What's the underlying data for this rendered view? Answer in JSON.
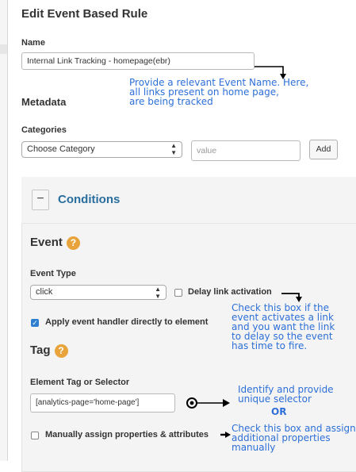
{
  "page": {
    "title": "Edit Event Based Rule"
  },
  "name_section": {
    "label": "Name",
    "value": "Internal Link Tracking - homepage(ebr)"
  },
  "metadata": {
    "label": "Metadata",
    "categories_label": "Categories",
    "category_select": "Choose Category",
    "value_placeholder": "value",
    "add_button": "Add"
  },
  "conditions": {
    "collapse_symbol": "−",
    "title": "Conditions",
    "event_heading": "Event",
    "event_type_label": "Event Type",
    "event_type_value": "click",
    "delay_label": "Delay link activation",
    "apply_label": "Apply event handler directly to element",
    "tag_heading": "Tag",
    "element_selector_label": "Element Tag or Selector",
    "element_selector_value": "[analytics-page='home-page']",
    "manually_assign_label": "Manually assign properties & attributes",
    "help_glyph": "?"
  },
  "checkboxes": {
    "delay_checked": false,
    "apply_checked": true,
    "manual_checked": false
  },
  "annotations": {
    "name_note": "Provide a relevant Event Name. Here,\nall links present on home page,\nare being tracked",
    "delay_note": "Check this box if the\nevent activates a link\nand you want the link\nto delay so the event\nhas time to fire.",
    "selector_note": "Identify and provide\nunique selector",
    "or_note": "OR",
    "manual_note": "Check this box and assign\nadditional properties\nmanually"
  },
  "colors": {
    "annotation": "#2d6fd8",
    "conditions_title": "#2a6e9e",
    "help_badge": "#e8a33a",
    "checkbox_checked": "#2f7fd1"
  },
  "icons": {
    "help": "question-circle-icon",
    "select_arrows": "up-down-chevron-icon",
    "collapse": "minus-icon"
  }
}
